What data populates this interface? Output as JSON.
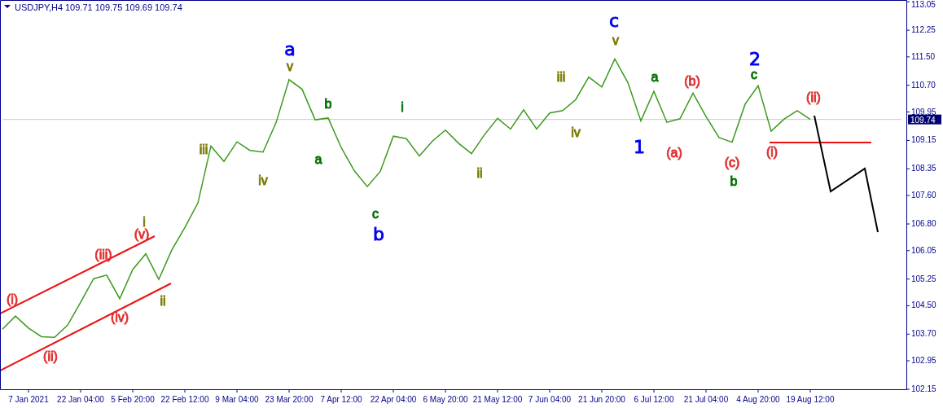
{
  "header": {
    "symbol": "USDJPY,H4",
    "quotes": "109.71 109.75 109.69 109.74"
  },
  "price_marker": {
    "label": "109.74"
  },
  "chart_data": {
    "type": "line",
    "ylim": [
      102.15,
      113.1
    ],
    "categories": [
      null,
      null,
      "7 Jan 2021",
      null,
      null,
      null,
      "22 Jan 04:00",
      null,
      null,
      null,
      "5 Feb 20:00",
      null,
      null,
      null,
      "22 Feb 12:00",
      null,
      null,
      null,
      "9 Mar 04:00",
      null,
      null,
      null,
      "23 Mar 20:00",
      null,
      null,
      null,
      "7 Apr 12:00",
      null,
      null,
      null,
      "22 Apr 04:00",
      null,
      null,
      null,
      "6 May 20:00",
      null,
      null,
      null,
      "21 May 12:00",
      null,
      null,
      null,
      "7 Jun 04:00",
      null,
      null,
      null,
      "21 Jun 20:00",
      null,
      null,
      null,
      "6 Jul 12:00",
      null,
      null,
      null,
      "21 Jul 04:00",
      null,
      null,
      null,
      "4 Aug 20:00",
      null,
      null,
      null,
      "19 Aug 12:00",
      null,
      null,
      null,
      null,
      null,
      null,
      null
    ],
    "yticks": [
      {
        "value": 113.05,
        "label": "113.05"
      },
      {
        "value": 112.25,
        "label": "112.25"
      },
      {
        "value": 111.5,
        "label": "111.50"
      },
      {
        "value": 110.7,
        "label": "110.70"
      },
      {
        "value": 109.95,
        "label": "109.95"
      },
      {
        "value": 109.15,
        "label": "109.15"
      },
      {
        "value": 108.35,
        "label": "108.35"
      },
      {
        "value": 107.6,
        "label": "107.60"
      },
      {
        "value": 106.8,
        "label": "106.80"
      },
      {
        "value": 106.05,
        "label": "106.05"
      },
      {
        "value": 105.25,
        "label": "105.25"
      },
      {
        "value": 104.5,
        "label": "104.50"
      },
      {
        "value": 103.7,
        "label": "103.70"
      },
      {
        "value": 102.95,
        "label": "102.95"
      },
      {
        "value": 102.15,
        "label": "102.15"
      }
    ],
    "series": [
      {
        "color": "#3c9a1e",
        "values": [
          103.84,
          104.21,
          103.87,
          103.63,
          103.61,
          103.95,
          104.6,
          105.26,
          105.36,
          104.7,
          105.52,
          105.96,
          105.24,
          106.07,
          106.7,
          107.39,
          108.99,
          108.56,
          109.11,
          108.87,
          108.82,
          109.65,
          110.86,
          110.59,
          109.73,
          109.78,
          108.95,
          108.3,
          107.85,
          108.28,
          109.27,
          109.2,
          108.71,
          109.13,
          109.44,
          109.07,
          108.78,
          109.31,
          109.77,
          109.47,
          110.01,
          109.47,
          109.92,
          109.99,
          110.3,
          110.93,
          110.65,
          111.44,
          110.78,
          109.7,
          110.53,
          109.66,
          109.76,
          110.48,
          109.82,
          109.23,
          109.1,
          110.17,
          110.69,
          109.41,
          109.75,
          109.99,
          109.74,
          null,
          null,
          null,
          null,
          null,
          null,
          null
        ]
      },
      {
        "color": "#c8c8c8",
        "values": [
          109.74,
          109.74,
          109.74,
          109.74,
          109.74,
          109.74,
          109.74,
          109.74,
          109.74,
          109.74,
          109.74,
          109.74,
          109.74,
          109.74,
          109.74,
          109.74,
          109.74,
          109.74,
          109.74,
          109.74,
          109.74,
          109.74,
          109.74,
          109.74,
          109.74,
          109.74,
          109.74,
          109.74,
          109.74,
          109.74,
          109.74,
          109.74,
          109.74,
          109.74,
          109.74,
          109.74,
          109.74,
          109.74,
          109.74,
          109.74,
          109.74,
          109.74,
          109.74,
          109.74,
          109.74,
          109.74,
          109.74,
          109.74,
          109.74,
          109.74,
          109.74,
          109.74,
          109.74,
          109.74,
          109.74,
          109.74,
          109.74,
          109.74,
          109.74,
          109.74,
          109.74,
          109.74,
          109.74,
          109.74,
          109.74,
          109.74,
          109.74,
          109.74,
          109.74,
          109.74
        ]
      }
    ]
  },
  "wave_labels": [
    {
      "text": "(i)",
      "color": "#e03030"
    },
    {
      "text": "(ii)",
      "color": "#e03030"
    },
    {
      "text": "(iii)",
      "color": "#e03030"
    },
    {
      "text": "(iv)",
      "color": "#e03030"
    },
    {
      "text": "(v)",
      "color": "#e03030"
    },
    {
      "text": "i",
      "color": "#7a7a00"
    },
    {
      "text": "ii",
      "color": "#7a7a00"
    },
    {
      "text": "iii",
      "color": "#7a7a00"
    },
    {
      "text": "iv",
      "color": "#7a7a00"
    },
    {
      "text": "a",
      "color": "#0000ee"
    },
    {
      "text": "v",
      "color": "#7a7a00"
    },
    {
      "text": "b",
      "color": "#007000"
    },
    {
      "text": "a",
      "color": "#007000"
    },
    {
      "text": "c",
      "color": "#007000"
    },
    {
      "text": "b",
      "color": "#0000ee"
    },
    {
      "text": "i",
      "color": "#007000"
    },
    {
      "text": "ii",
      "color": "#7a7a00"
    },
    {
      "text": "iii",
      "color": "#7a7a00"
    },
    {
      "text": "iv",
      "color": "#7a7a00"
    },
    {
      "text": "c",
      "color": "#0000ee"
    },
    {
      "text": "v",
      "color": "#7a7a00"
    },
    {
      "text": "1",
      "color": "#0000ee"
    },
    {
      "text": "a",
      "color": "#007000"
    },
    {
      "text": "(b)",
      "color": "#e03030"
    },
    {
      "text": "(a)",
      "color": "#e03030"
    },
    {
      "text": "(c)",
      "color": "#e03030"
    },
    {
      "text": "b",
      "color": "#007000"
    },
    {
      "text": "2",
      "color": "#0000ee"
    },
    {
      "text": "c",
      "color": "#007000"
    },
    {
      "text": "(ii)",
      "color": "#e03030"
    },
    {
      "text": "(i)",
      "color": "#e03030"
    }
  ]
}
